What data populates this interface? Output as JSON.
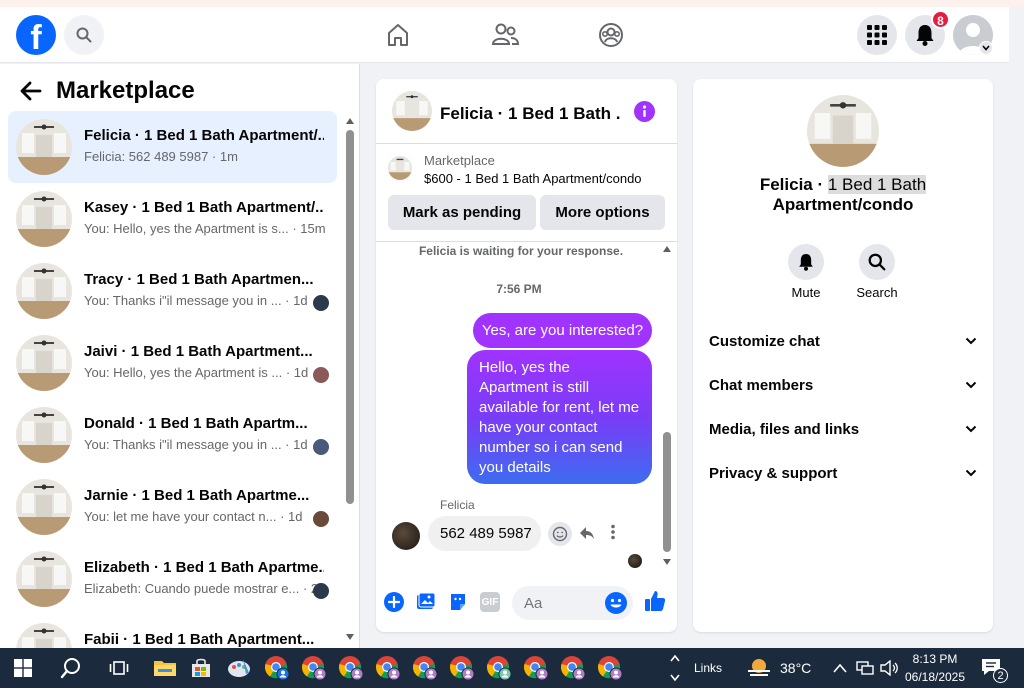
{
  "header": {
    "brand": "f",
    "notification_count": "8"
  },
  "sidebar": {
    "title": "Marketplace",
    "conversations": [
      {
        "name": "Felicia · 1 Bed 1 Bath Apartment/...",
        "preview": "Felicia: 562 489 5987 · 1m",
        "active": true
      },
      {
        "name": "Kasey · 1 Bed 1 Bath Apartment/...",
        "preview": "You: Hello, yes the Apartment is s... · 15m"
      },
      {
        "name": "Tracy · 1 Bed 1 Bath Apartmen...",
        "preview": "You: Thanks i\"il message you in ... · 1d"
      },
      {
        "name": "Jaivi · 1 Bed 1 Bath Apartment...",
        "preview": "You: Hello, yes the Apartment is ... · 1d"
      },
      {
        "name": "Donald · 1 Bed 1 Bath Apartm...",
        "preview": "You: Thanks i\"il message you in ... · 1d"
      },
      {
        "name": "Jarnie · 1 Bed 1 Bath Apartme...",
        "preview": "You: let me have your contact n... · 1d"
      },
      {
        "name": "Elizabeth · 1 Bed 1 Bath Apartme...",
        "preview": "Elizabeth: Cuando puede mostrar e... · 2d"
      },
      {
        "name": "Fabii · 1 Bed 1 Bath Apartment...",
        "preview": ""
      }
    ]
  },
  "chat": {
    "title": "Felicia · 1 Bed 1 Bath ...",
    "listing_label": "Marketplace",
    "listing_price": "$600 - 1 Bed 1 Bath Apartment/condo",
    "mark_pending": "Mark as pending",
    "more_options": "More options",
    "waiting_text": "Felicia is waiting for your response.",
    "timestamp": "7:56 PM",
    "msg_out_1": "Yes, are you interested?",
    "msg_out_2": "Hello, yes the Apartment is still available for rent, let me have your contact number so i can send you details",
    "sender_name": "Felicia",
    "msg_in_1": "562 489 5987",
    "input_placeholder": "Aa",
    "gif_label": "GIF"
  },
  "info_panel": {
    "name_part1": "Felicia · ",
    "name_part2": "1 Bed 1 Bath",
    "name_line2": "Apartment/condo",
    "mute_label": "Mute",
    "search_label": "Search",
    "sections": [
      "Customize chat",
      "Chat members",
      "Media, files and links",
      "Privacy & support"
    ]
  },
  "taskbar": {
    "links_label": "Links",
    "temperature": "38°C",
    "time": "8:13 PM",
    "date": "06/18/2025",
    "notification_count": "2"
  },
  "colors": {
    "brand_blue": "#0866ff",
    "messenger_purple": "#a033ff",
    "badge_red": "#e41e3f",
    "taskbar": "#1b2b3d"
  }
}
